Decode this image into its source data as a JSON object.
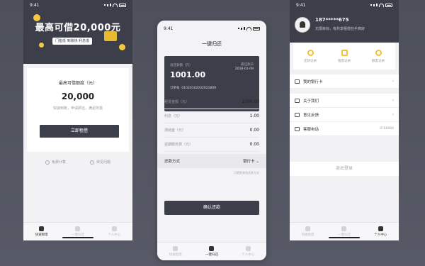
{
  "status_time": "9:41",
  "screen1": {
    "hero_title": "最高可借20,000元",
    "hero_tag": "门槛低  到账快  利息低",
    "card_label": "最高可借额度（元）",
    "card_amount": "20,000",
    "card_sub": "快速到账，申请即还，满足所需",
    "apply_button": "立即租借",
    "links": [
      "免费计算",
      "常见问题"
    ]
  },
  "screen2": {
    "title": "一键归还",
    "card": {
      "label": "总还款额（元）",
      "due_label": "最还款日",
      "due_date": "2018-01-09",
      "amount": "1001.00",
      "order_label": "订单号",
      "order_no": "01020102032021809"
    },
    "rows": [
      {
        "label": "租赁金额（元）",
        "value": "1000.00"
      },
      {
        "label": "利息（元）",
        "value": "1.00"
      },
      {
        "label": "滞纳金（元）",
        "value": "0.00"
      },
      {
        "label": "逾期服务费（元）",
        "value": "0.00"
      }
    ],
    "pay_label": "还款方式",
    "pay_value": "银行卡",
    "hint": "可更换其他还款方式",
    "confirm_button": "确认还款"
  },
  "screen3": {
    "phone": "187*****675",
    "tagline": "无惧目标，有共享租借在手真好",
    "quick": [
      "还款记录",
      "租借记录",
      "额度记录"
    ],
    "menu": [
      {
        "label": "我的银行卡",
        "value": ""
      },
      {
        "label": "关于我们",
        "value": ""
      },
      {
        "label": "意见反馈",
        "value": ""
      },
      {
        "label": "客服电话",
        "value": "8788888"
      }
    ],
    "logout": "退出登录"
  },
  "tabs": [
    "快速租借",
    "一键归还",
    "个人中心"
  ]
}
